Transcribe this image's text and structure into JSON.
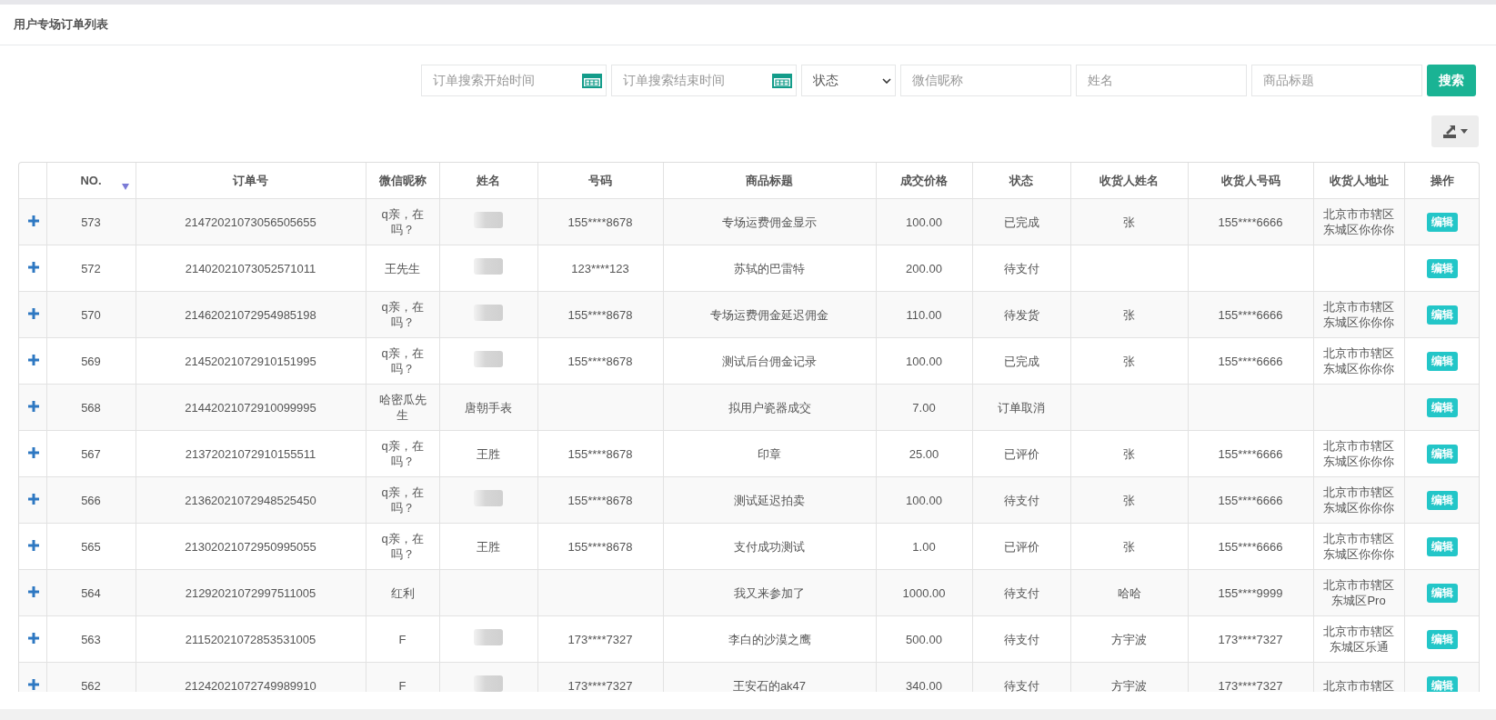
{
  "page_title": "用户专场订单列表",
  "search": {
    "fields": [
      {
        "kind": "date",
        "placeholder": "订单搜索开始时间"
      },
      {
        "kind": "date",
        "placeholder": "订单搜索结束时间"
      },
      {
        "kind": "select",
        "value": "状态"
      },
      {
        "kind": "text",
        "placeholder": "微信昵称"
      },
      {
        "kind": "text",
        "placeholder": "姓名"
      },
      {
        "kind": "text",
        "placeholder": "商品标题"
      }
    ],
    "button": "搜索"
  },
  "table": {
    "columns": [
      {
        "label": "NO.",
        "sorted": true
      },
      {
        "label": "订单号"
      },
      {
        "label": "微信昵称"
      },
      {
        "label": "姓名"
      },
      {
        "label": "号码"
      },
      {
        "label": "商品标题"
      },
      {
        "label": "成交价格"
      },
      {
        "label": "状态"
      },
      {
        "label": "收货人姓名"
      },
      {
        "label": "收货人号码"
      },
      {
        "label": "收货人地址"
      },
      {
        "label": "操作"
      }
    ],
    "rows": [
      {
        "no": "573",
        "order": "21472021073056505655",
        "nickname": "q亲，在吗？",
        "name_blurred": true,
        "phone": "155****8678",
        "title": "专场运费佣金显示",
        "price": "100.00",
        "status": "已完成",
        "recv_name": "张",
        "recv_phone": "155****6666",
        "address": "北京市市辖区东城区你你你",
        "action": "编辑"
      },
      {
        "no": "572",
        "order": "21402021073052571011",
        "nickname": "王先生",
        "name_blurred": true,
        "phone": "123****123",
        "title": "苏轼的巴雷特",
        "price": "200.00",
        "status": "待支付",
        "action": "编辑"
      },
      {
        "no": "570",
        "order": "21462021072954985198",
        "nickname": "q亲，在吗？",
        "name_blurred": true,
        "phone": "155****8678",
        "title": "专场运费佣金延迟佣金",
        "price": "110.00",
        "status": "待发货",
        "recv_name": "张",
        "recv_phone": "155****6666",
        "address": "北京市市辖区东城区你你你",
        "action": "编辑"
      },
      {
        "no": "569",
        "order": "21452021072910151995",
        "nickname": "q亲，在吗？",
        "name_blurred": true,
        "phone": "155****8678",
        "title": "测试后台佣金记录",
        "price": "100.00",
        "status": "已完成",
        "recv_name": "张",
        "recv_phone": "155****6666",
        "address": "北京市市辖区东城区你你你",
        "action": "编辑"
      },
      {
        "no": "568",
        "order": "21442021072910099995",
        "nickname": "哈密瓜先生",
        "name": "唐朝手表",
        "title": "拟用户瓷器成交",
        "price": "7.00",
        "status": "订单取消",
        "action": "编辑"
      },
      {
        "no": "567",
        "order": "21372021072910155511",
        "nickname": "q亲，在吗？",
        "name": "王胜",
        "phone": "155****8678",
        "title": "印章",
        "price": "25.00",
        "status": "已评价",
        "recv_name": "张",
        "recv_phone": "155****6666",
        "address": "北京市市辖区东城区你你你",
        "action": "编辑"
      },
      {
        "no": "566",
        "order": "21362021072948525450",
        "nickname": "q亲，在吗？",
        "name_blurred": true,
        "phone": "155****8678",
        "title": "测试延迟拍卖",
        "price": "100.00",
        "status": "待支付",
        "recv_name": "张",
        "recv_phone": "155****6666",
        "address": "北京市市辖区东城区你你你",
        "action": "编辑"
      },
      {
        "no": "565",
        "order": "21302021072950995055",
        "nickname": "q亲，在吗？",
        "name": "王胜",
        "phone": "155****8678",
        "title": "支付成功测试",
        "price": "1.00",
        "status": "已评价",
        "recv_name": "张",
        "recv_phone": "155****6666",
        "address": "北京市市辖区东城区你你你",
        "action": "编辑"
      },
      {
        "no": "564",
        "order": "21292021072997511005",
        "nickname": "红利",
        "title": "我又来参加了",
        "price": "1000.00",
        "status": "待支付",
        "recv_name": "哈哈",
        "recv_phone": "155****9999",
        "address": "北京市市辖区东城区Pro",
        "action": "编辑"
      },
      {
        "no": "563",
        "order": "21152021072853531005",
        "nickname": "F",
        "name_blurred": true,
        "phone": "173****7327",
        "title": "李白的沙漠之鹰",
        "price": "500.00",
        "status": "待支付",
        "recv_name": "方宇波",
        "recv_phone": "173****7327",
        "address": "北京市市辖区东城区乐通",
        "action": "编辑"
      },
      {
        "no": "562",
        "order": "21242021072749989910",
        "nickname": "F",
        "name_blurred": true,
        "phone": "173****7327",
        "title": "王安石的ak47",
        "price": "340.00",
        "status": "待支付",
        "recv_name": "方宇波",
        "recv_phone": "173****7327",
        "address": "北京市市辖区",
        "action": "编辑"
      }
    ]
  }
}
